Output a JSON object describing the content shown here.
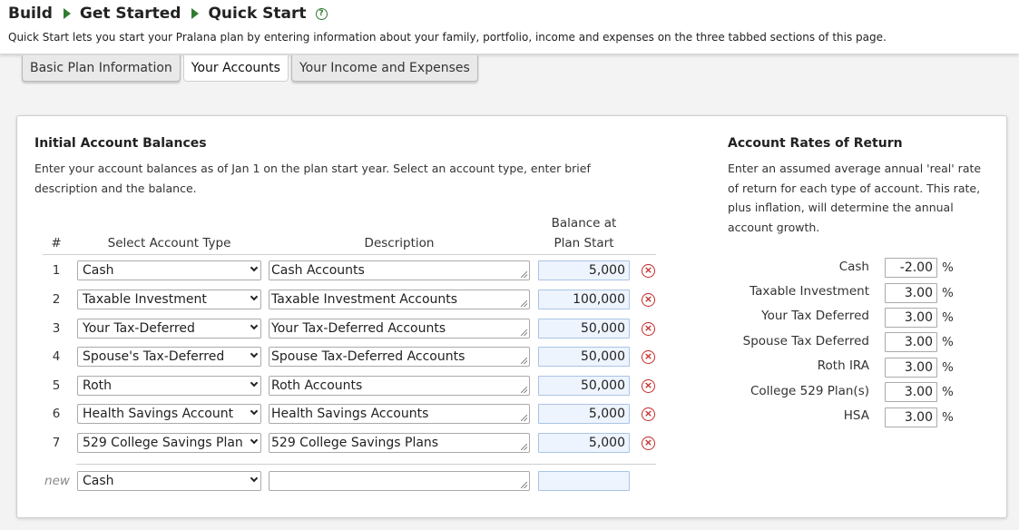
{
  "header": {
    "breadcrumb": [
      "Build",
      "Get Started",
      "Quick Start"
    ],
    "subtitle": "Quick Start lets you start your Pralana plan by entering information about your family, portfolio, income and expenses on the three tabbed sections of this page."
  },
  "tabs": [
    {
      "label": "Basic Plan Information",
      "active": false
    },
    {
      "label": "Your Accounts",
      "active": true
    },
    {
      "label": "Your Income and Expenses",
      "active": false
    }
  ],
  "balances": {
    "title": "Initial Account Balances",
    "description": "Enter your account balances as of Jan 1 on the plan start year. Select an account type, enter brief description and the balance.",
    "columns": {
      "num": "#",
      "type": "Select Account Type",
      "description": "Description",
      "balance_line1": "Balance at",
      "balance_line2": "Plan Start"
    },
    "rows": [
      {
        "num": "1",
        "type": "Cash",
        "description": "Cash Accounts",
        "balance": "5,000"
      },
      {
        "num": "2",
        "type": "Taxable Investment",
        "description": "Taxable Investment Accounts",
        "balance": "100,000"
      },
      {
        "num": "3",
        "type": "Your Tax-Deferred",
        "description": "Your Tax-Deferred Accounts",
        "balance": "50,000"
      },
      {
        "num": "4",
        "type": "Spouse's Tax-Deferred",
        "description": "Spouse Tax-Deferred Accounts",
        "balance": "50,000"
      },
      {
        "num": "5",
        "type": "Roth",
        "description": "Roth Accounts",
        "balance": "50,000"
      },
      {
        "num": "6",
        "type": "Health Savings Account",
        "description": "Health Savings Accounts",
        "balance": "5,000"
      },
      {
        "num": "7",
        "type": "529 College Savings Plan",
        "description": "529 College Savings Plans",
        "balance": "5,000"
      }
    ],
    "new_row": {
      "label": "new",
      "type": "Cash",
      "description": "",
      "balance": ""
    }
  },
  "rates": {
    "title": "Account Rates of Return",
    "description": "Enter an assumed average annual 'real' rate of return for each type of account. This rate, plus inflation, will determine the annual account growth.",
    "unit": "%",
    "items": [
      {
        "label": "Cash",
        "value": "-2.00"
      },
      {
        "label": "Taxable Investment",
        "value": "3.00"
      },
      {
        "label": "Your Tax Deferred",
        "value": "3.00"
      },
      {
        "label": "Spouse Tax Deferred",
        "value": "3.00"
      },
      {
        "label": "Roth IRA",
        "value": "3.00"
      },
      {
        "label": "College 529 Plan(s)",
        "value": "3.00"
      },
      {
        "label": "HSA",
        "value": "3.00"
      }
    ]
  }
}
